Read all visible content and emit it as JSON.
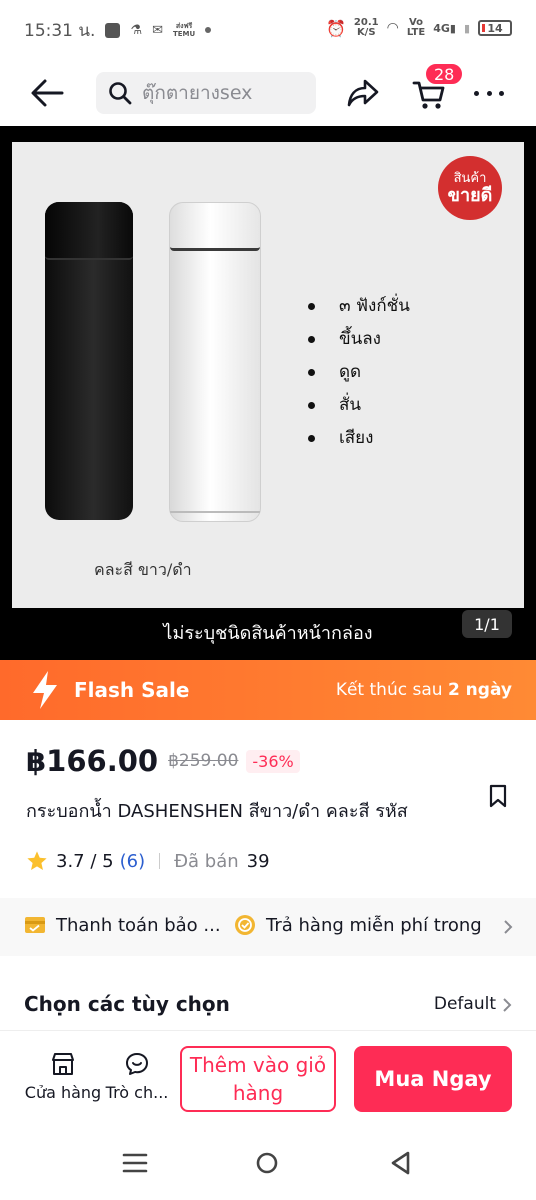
{
  "status_bar": {
    "time": "15:31 น.",
    "network_speed": "20.1",
    "network_unit": "K/S",
    "volte_top": "Vo",
    "volte_bottom": "LTE",
    "signal": "4G",
    "battery": "14",
    "temu_top": "ส่งฟรี",
    "temu_bottom": "TEMU"
  },
  "header": {
    "search_placeholder": "ตุ๊กตายางsex",
    "cart_count": "28",
    "icons": [
      "back-arrow-icon",
      "search-icon",
      "share-icon",
      "cart-icon",
      "more-icon"
    ]
  },
  "gallery": {
    "badge_line1": "สินค้า",
    "badge_line2": "ขายดี",
    "features": [
      "๓ ฟังก์ชั่น",
      "ขึ้นลง",
      "ดูด",
      "สั่น",
      "เสียง"
    ],
    "color_note": "คละสี  ขาว/ดำ",
    "caption": "ไม่ระบุชนิดสินค้าหน้ากล่อง",
    "counter": "1/1"
  },
  "flash_sale": {
    "title": "Flash Sale",
    "ends_label": "Kết thúc sau",
    "ends_value": "2 ngày"
  },
  "product": {
    "price": "฿166.00",
    "original_price": "฿259.00",
    "discount": "-36%",
    "title": "กระบอกน้ำ DASHENSHEN สีขาว/ดำ คละสี รหัส",
    "rating": "3.7 / 5",
    "review_count": "(6)",
    "sold_label": "Đã bán",
    "sold_value": "39"
  },
  "promos": {
    "item1": "Thanh toán bảo ...",
    "item2": "Trả hàng miễn phí trong"
  },
  "options": {
    "label": "Chọn các tùy chọn",
    "value": "Default"
  },
  "action_bar": {
    "shop_label": "Cửa hàng",
    "chat_label": "Trò ch...",
    "add_to_cart": "Thêm vào giỏ hàng",
    "buy_now": "Mua Ngay"
  },
  "colors": {
    "accent": "#fe2c55",
    "flash_start": "#ff6a2b",
    "flash_end": "#ff8a34",
    "link": "#2b5ecf"
  }
}
